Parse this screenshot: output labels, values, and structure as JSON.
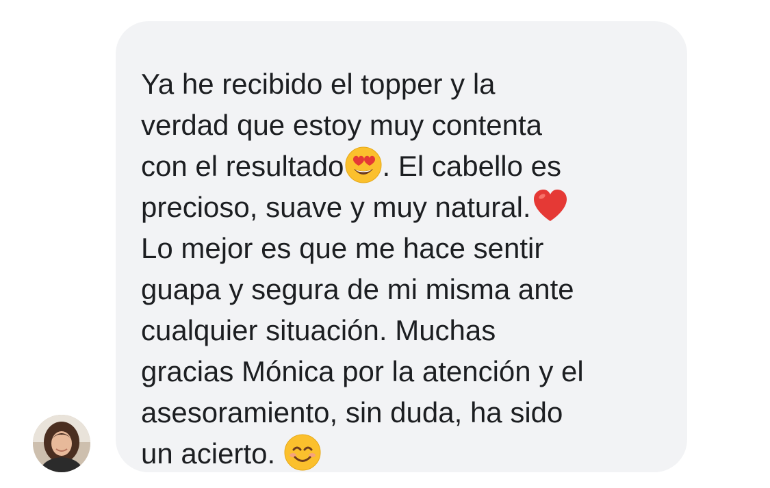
{
  "message": {
    "lines": [
      "Ya he recibido el topper y la",
      "verdad que estoy muy contenta",
      "con el resultado",
      ". El cabello es",
      "precioso, suave y muy natural.",
      "Lo mejor es que me hace sentir",
      "guapa y segura de mi misma ante",
      "cualquier situación. Muchas",
      "gracias Mónica por la atención y el",
      "asesoramiento, sin duda, ha sido",
      "un acierto."
    ],
    "emojis": {
      "heart_eyes": "smiling-face-with-heart-eyes-icon",
      "heart": "red-heart-icon",
      "smile": "smiling-face-with-smiling-eyes-icon"
    }
  },
  "colors": {
    "bubble_background": "#f2f3f5",
    "text": "#1c1e21",
    "emoji_face": "#fbc02d",
    "heart": "#e53935"
  }
}
